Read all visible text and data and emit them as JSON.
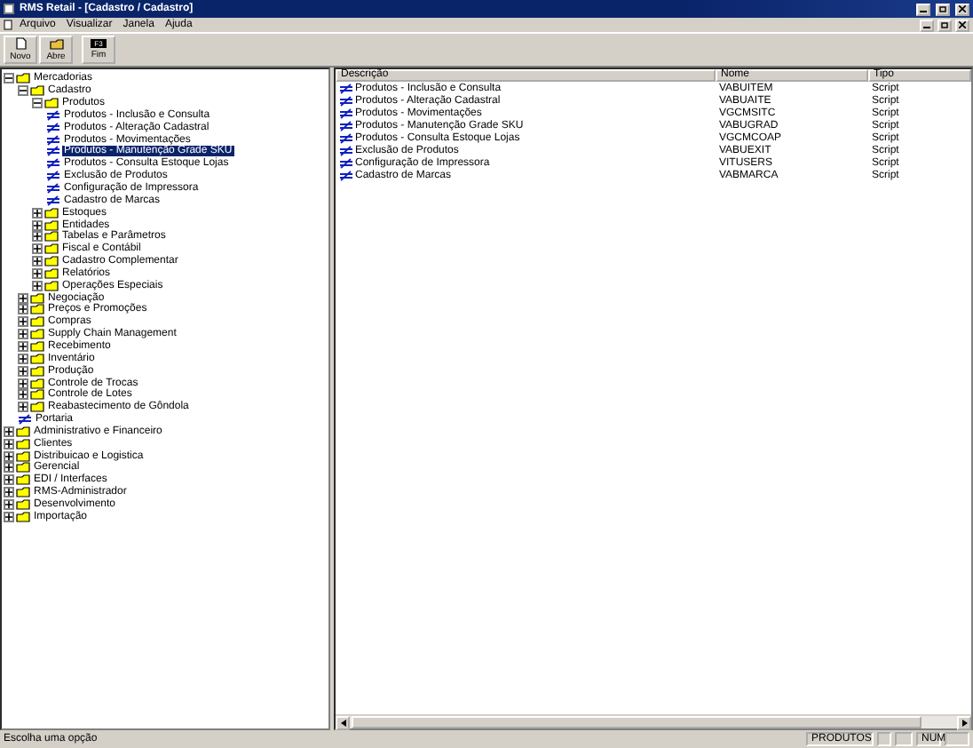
{
  "window": {
    "title": "RMS Retail - [Cadastro / Cadastro]"
  },
  "menu": [
    "Arquivo",
    "Visualizar",
    "Janela",
    "Ajuda"
  ],
  "toolbar": [
    {
      "kind": "new",
      "label": "Novo"
    },
    {
      "kind": "open",
      "label": "Abre"
    },
    {
      "kind": "exit",
      "label": "Fim",
      "key_hint": "F3"
    }
  ],
  "tree": [
    {
      "kind": "folder",
      "label": "Mercadorias",
      "expanded": true,
      "selected": false,
      "children": [
        {
          "kind": "folder",
          "label": "Cadastro",
          "expanded": true,
          "selected": false,
          "children": [
            {
              "kind": "folder",
              "label": "Produtos",
              "expanded": true,
              "selected": false,
              "children": [
                {
                  "kind": "script",
                  "label": "Produtos - Inclusão e Consulta",
                  "selected": false
                },
                {
                  "kind": "script",
                  "label": "Produtos - Alteração Cadastral",
                  "selected": false
                },
                {
                  "kind": "script",
                  "label": "Produtos - Movimentações",
                  "selected": false
                },
                {
                  "kind": "script",
                  "label": "Produtos - Manutenção Grade SKU",
                  "selected": true
                },
                {
                  "kind": "script",
                  "label": "Produtos - Consulta Estoque Lojas",
                  "selected": false
                },
                {
                  "kind": "script",
                  "label": "Exclusão de Produtos",
                  "selected": false
                },
                {
                  "kind": "script",
                  "label": "Configuração de Impressora",
                  "selected": false
                },
                {
                  "kind": "script",
                  "label": "Cadastro de Marcas",
                  "selected": false
                }
              ]
            },
            {
              "kind": "folder",
              "label": "Estoques",
              "expanded": false,
              "selected": false
            },
            {
              "kind": "folder",
              "label": "Entidades",
              "expanded": false,
              "selected": false
            },
            {
              "kind": "folder",
              "label": "Tabelas e Parâmetros",
              "expanded": false,
              "selected": false
            },
            {
              "kind": "folder",
              "label": "Fiscal e Contábil",
              "expanded": false,
              "selected": false
            },
            {
              "kind": "folder",
              "label": "Cadastro Complementar",
              "expanded": false,
              "selected": false
            },
            {
              "kind": "folder",
              "label": "Relatórios",
              "expanded": false,
              "selected": false
            },
            {
              "kind": "folder",
              "label": "Operações Especiais",
              "expanded": false,
              "selected": false
            }
          ]
        },
        {
          "kind": "folder",
          "label": "Negociação",
          "expanded": false,
          "selected": false
        },
        {
          "kind": "folder",
          "label": "Preços e Promoções",
          "expanded": false,
          "selected": false
        },
        {
          "kind": "folder",
          "label": "Compras",
          "expanded": false,
          "selected": false
        },
        {
          "kind": "folder",
          "label": "Supply Chain Management",
          "expanded": false,
          "selected": false
        },
        {
          "kind": "folder",
          "label": "Recebimento",
          "expanded": false,
          "selected": false
        },
        {
          "kind": "folder",
          "label": "Inventário",
          "expanded": false,
          "selected": false
        },
        {
          "kind": "folder",
          "label": "Produção",
          "expanded": false,
          "selected": false
        },
        {
          "kind": "folder",
          "label": "Controle de Trocas",
          "expanded": false,
          "selected": false
        },
        {
          "kind": "folder",
          "label": "Controle de Lotes",
          "expanded": false,
          "selected": false
        },
        {
          "kind": "folder",
          "label": "Reabastecimento de Gôndola",
          "expanded": false,
          "selected": false
        },
        {
          "kind": "script",
          "label": "Portaria",
          "selected": false
        }
      ]
    },
    {
      "kind": "folder",
      "label": "Administrativo e Financeiro",
      "expanded": false,
      "selected": false
    },
    {
      "kind": "folder",
      "label": "Clientes",
      "expanded": false,
      "selected": false
    },
    {
      "kind": "folder",
      "label": "Distribuicao e Logistica",
      "expanded": false,
      "selected": false
    },
    {
      "kind": "folder",
      "label": "Gerencial",
      "expanded": false,
      "selected": false
    },
    {
      "kind": "folder",
      "label": "EDI / Interfaces",
      "expanded": false,
      "selected": false
    },
    {
      "kind": "folder",
      "label": "RMS-Administrador",
      "expanded": false,
      "selected": false
    },
    {
      "kind": "folder",
      "label": "Desenvolvimento",
      "expanded": false,
      "selected": false
    },
    {
      "kind": "folder",
      "label": "Importação",
      "expanded": false,
      "selected": false
    }
  ],
  "table": {
    "columns": [
      "Descrição",
      "Nome",
      "Tipo"
    ],
    "rows": [
      [
        "Produtos - Inclusão e Consulta",
        "VABUITEM",
        "Script"
      ],
      [
        "Produtos - Alteração Cadastral",
        "VABUAITE",
        "Script"
      ],
      [
        "Produtos - Movimentações",
        "VGCMSITC",
        "Script"
      ],
      [
        "Produtos - Manutenção Grade SKU",
        "VABUGRAD",
        "Script"
      ],
      [
        "Produtos - Consulta Estoque Lojas",
        "VGCMCOAP",
        "Script"
      ],
      [
        "Exclusão de Produtos",
        "VABUEXIT",
        "Script"
      ],
      [
        "Configuração de Impressora",
        "VITUSERS",
        "Script"
      ],
      [
        "Cadastro de Marcas",
        "VABMARCA",
        "Script"
      ]
    ]
  },
  "status_bar": {
    "message": "Escolha uma opção",
    "module": "PRODUTOS",
    "num_lock": "NUM"
  }
}
